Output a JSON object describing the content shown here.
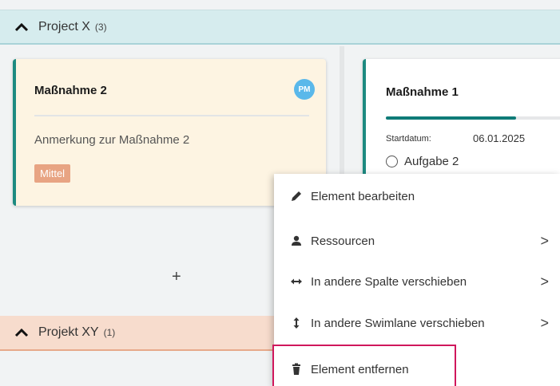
{
  "swimlanes": [
    {
      "title": "Project X",
      "count": "(3)"
    },
    {
      "title": "Projekt XY",
      "count": "(1)"
    }
  ],
  "cards": {
    "massnahme2": {
      "title": "Maßnahme 2",
      "avatar": "PM",
      "note": "Anmerkung zur Maßnahme 2",
      "priority": "Mittel"
    },
    "massnahme1": {
      "title": "Maßnahme 1",
      "start_label": "Startdatum:",
      "start_date": "06.01.2025",
      "task": "Aufgabe 2",
      "progress": 0.68
    }
  },
  "add_label": "+",
  "context_menu": {
    "items": [
      {
        "label": "Element bearbeiten",
        "icon": "pencil-icon",
        "submenu": false
      },
      {
        "label": "Ressourcen",
        "icon": "person-icon",
        "submenu": true
      },
      {
        "label": "In andere Spalte verschieben",
        "icon": "horizontal-arrows-icon",
        "submenu": true
      },
      {
        "label": "In andere Swimlane verschieben",
        "icon": "vertical-arrows-icon",
        "submenu": true
      },
      {
        "label": "Element entfernen",
        "icon": "trash-icon",
        "submenu": false
      }
    ],
    "arrow": ">"
  },
  "colors": {
    "accent_teal": "#1d8a80",
    "priority_badge": "#e8a483",
    "highlight": "#d0175c",
    "avatar": "#5ab8ea"
  }
}
